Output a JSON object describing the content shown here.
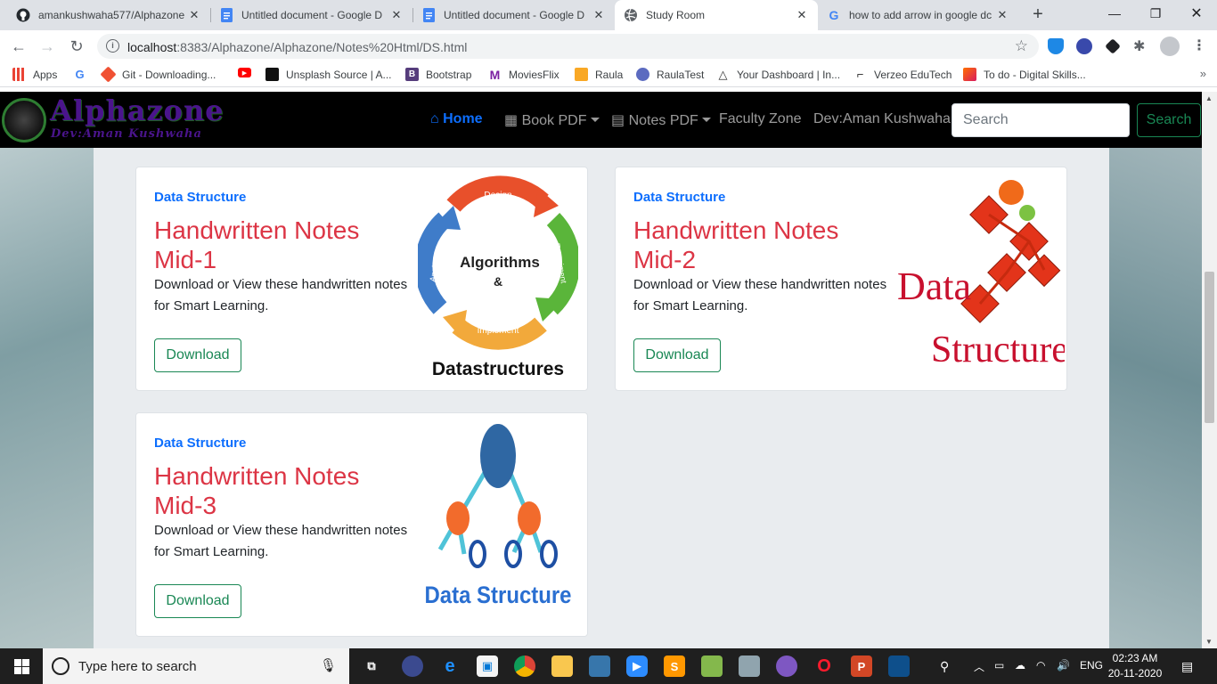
{
  "browser": {
    "tabs": [
      {
        "title": "amankushwaha577/Alphazone",
        "icon": "github-icon"
      },
      {
        "title": "Untitled document - Google D",
        "icon": "google-docs-icon"
      },
      {
        "title": "Untitled document - Google D",
        "icon": "google-docs-icon"
      },
      {
        "title": "Study Room",
        "icon": "globe-icon",
        "active": true
      },
      {
        "title": "how to add arrow in google dc",
        "icon": "google-icon"
      }
    ],
    "url_host": "localhost",
    "url_rest": ":8383/Alphazone/Alphazone/Notes%20Html/DS.html",
    "bookmarks": [
      {
        "label": "Apps",
        "icon": "apps-grid-icon"
      },
      {
        "label": "",
        "icon": "google-icon"
      },
      {
        "label": "Git - Downloading...",
        "icon": "git-icon"
      },
      {
        "label": "",
        "icon": "youtube-icon"
      },
      {
        "label": "Unsplash Source | A...",
        "icon": "unsplash-icon"
      },
      {
        "label": "Bootstrap",
        "icon": "bootstrap-icon"
      },
      {
        "label": "MoviesFlix",
        "icon": "moviesflix-icon"
      },
      {
        "label": "Raula",
        "icon": "raula-icon"
      },
      {
        "label": "RaulaTest",
        "icon": "raulatest-icon"
      },
      {
        "label": "Your Dashboard | In...",
        "icon": "dashboard-icon"
      },
      {
        "label": "Verzeo EduTech",
        "icon": "verzeo-icon"
      },
      {
        "label": "To do - Digital Skills...",
        "icon": "todo-icon"
      }
    ]
  },
  "site": {
    "logo_title": "Alphazone",
    "logo_subtitle": "Dev:Aman Kushwaha",
    "nav": {
      "home": "Home",
      "book_pdf": "Book PDF",
      "notes_pdf": "Notes PDF",
      "faculty": "Faculty Zone",
      "dev": "Dev:Aman Kushwaha"
    },
    "search_placeholder": "Search",
    "search_button": "Search"
  },
  "cards": [
    {
      "category": "Data Structure",
      "title": "Handwritten Notes Mid-1",
      "description": "Download or View these handwritten notes for Smart Learning.",
      "button": "Download",
      "image": "algorithms-datastructures-cycle"
    },
    {
      "category": "Data Structure",
      "title": "Handwritten Notes Mid-2",
      "description": "Download or View these handwritten notes for Smart Learning.",
      "button": "Download",
      "image": "data-structure-diamonds"
    },
    {
      "category": "Data Structure",
      "title": "Handwritten Notes Mid-3",
      "description": "Download or View these handwritten notes for Smart Learning.",
      "button": "Download",
      "image": "data-structure-tree"
    }
  ],
  "images": {
    "cycle": {
      "design": "Design",
      "experiment": "Experiment",
      "implement": "Implement",
      "analyze": "Analyze",
      "center1": "Algorithms",
      "center2": "&",
      "caption": "Datastructures"
    },
    "diamonds": {
      "word1": "Data",
      "word2": "Structure"
    },
    "tree": {
      "caption": "Data Structure"
    }
  },
  "taskbar": {
    "search_placeholder": "Type here to search",
    "language": "ENG",
    "time": "02:23 AM",
    "date": "20-11-2020"
  },
  "colors": {
    "primary": "#0d6efd",
    "danger": "#dc3545",
    "success": "#198754",
    "navbar": "#000000"
  }
}
